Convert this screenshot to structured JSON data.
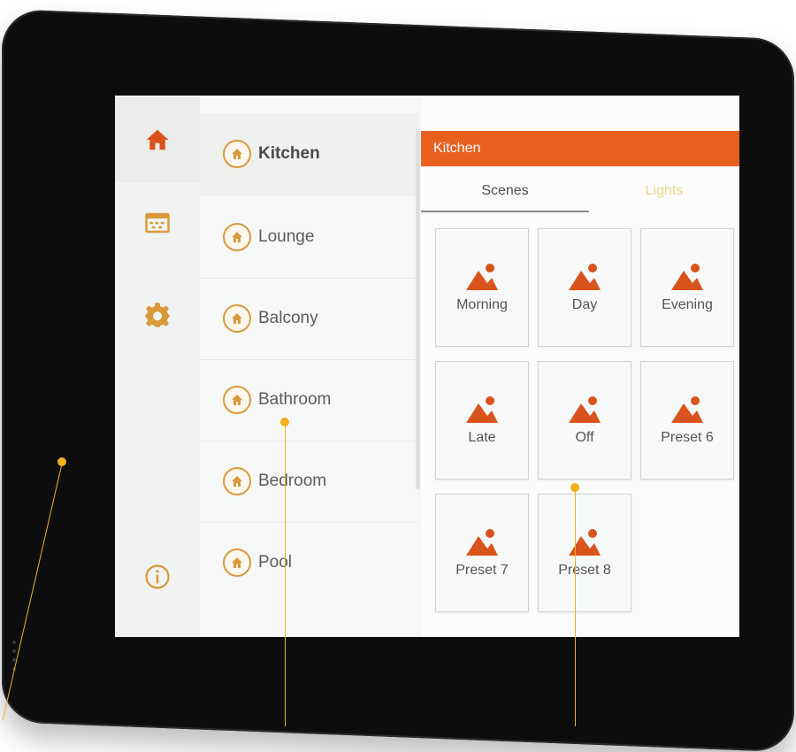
{
  "colors": {
    "accent": "#e95f1e",
    "icon_orange": "#d9531c",
    "icon_gold": "#d99a3b",
    "callout_yellow": "#f2b01e",
    "bezel": "#0d0d0d"
  },
  "sidebar": {
    "items": [
      {
        "name": "home-icon",
        "active": true
      },
      {
        "name": "schedule-icon",
        "active": false
      },
      {
        "name": "settings-gear-icon",
        "active": false
      },
      {
        "name": "info-icon",
        "active": false
      }
    ]
  },
  "rooms": {
    "items": [
      {
        "label": "Kitchen",
        "active": true
      },
      {
        "label": "Lounge",
        "active": false
      },
      {
        "label": "Balcony",
        "active": false
      },
      {
        "label": "Bathroom",
        "active": false
      },
      {
        "label": "Bedroom",
        "active": false
      },
      {
        "label": "Pool",
        "active": false
      }
    ]
  },
  "panel": {
    "header": "Kitchen",
    "tabs": [
      {
        "label": "Scenes",
        "selected": true
      },
      {
        "label": "Lights",
        "selected": false
      }
    ],
    "scenes": [
      {
        "label": "Morning"
      },
      {
        "label": "Day"
      },
      {
        "label": "Evening"
      },
      {
        "label": "Late"
      },
      {
        "label": "Off"
      },
      {
        "label": "Preset 6"
      },
      {
        "label": "Preset 7"
      },
      {
        "label": "Preset 8"
      }
    ]
  }
}
